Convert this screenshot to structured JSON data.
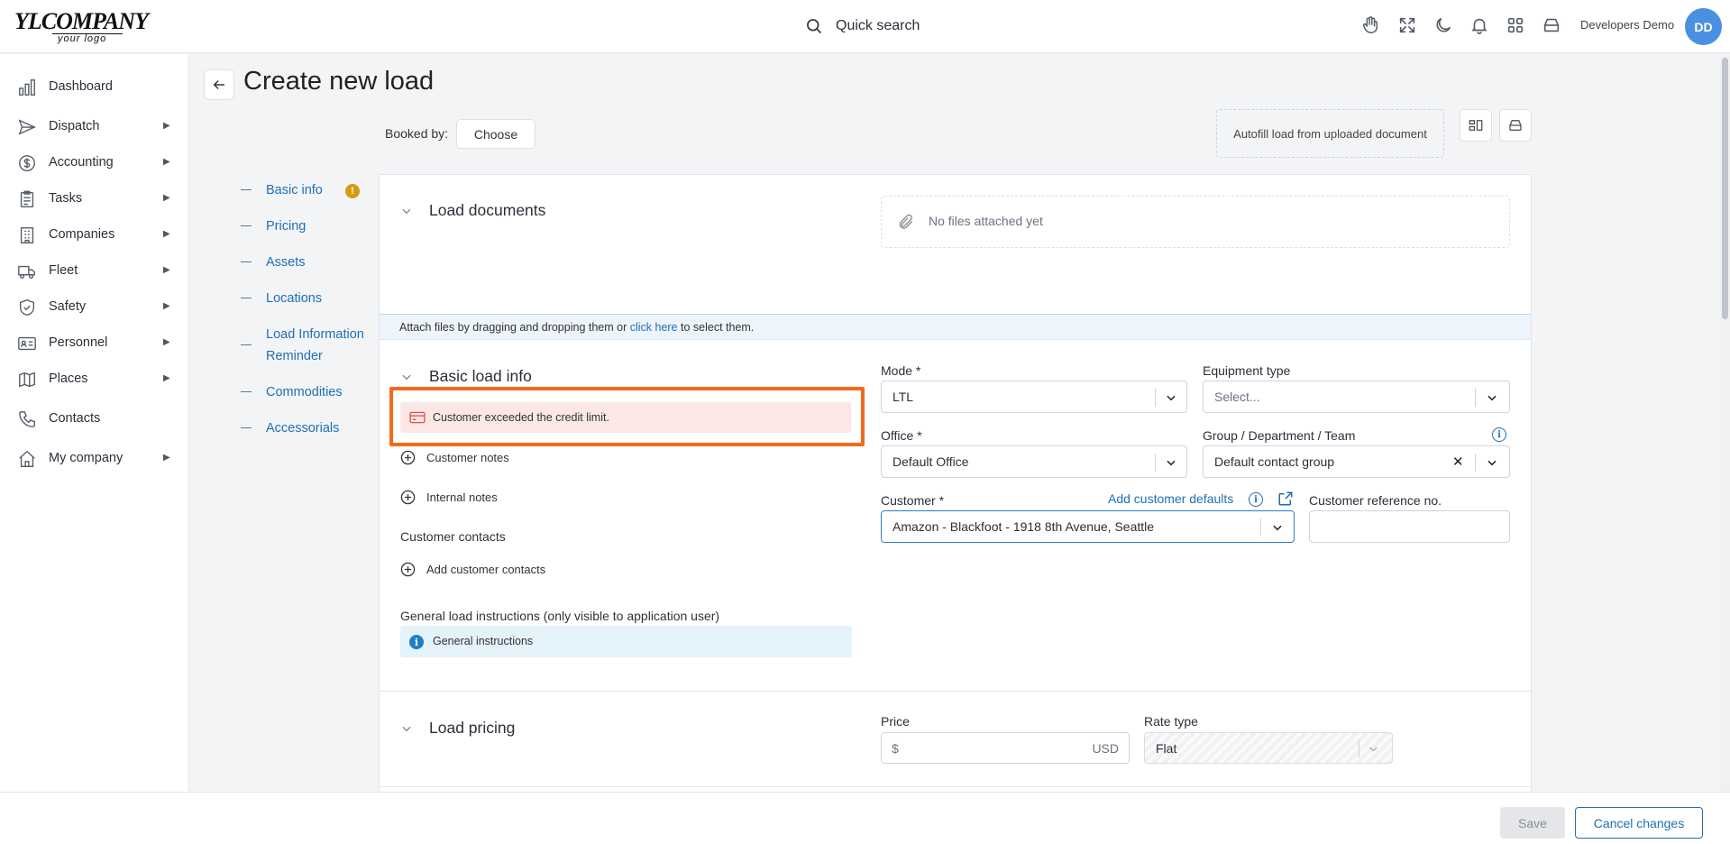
{
  "header": {
    "logo_main": "YLCOMPANY",
    "logo_sub": "your logo",
    "search_label": "Quick search",
    "user_name": "Developers Demo",
    "avatar_initials": "DD",
    "icons": [
      "hand-icon",
      "fullscreen-icon",
      "moon-icon",
      "bell-icon",
      "apps-grid-icon",
      "inbox-icon"
    ]
  },
  "sidebar": {
    "items": [
      {
        "label": "Dashboard",
        "icon": "dashboard-icon",
        "expandable": false
      },
      {
        "label": "Dispatch",
        "icon": "dispatch-icon",
        "expandable": true
      },
      {
        "label": "Accounting",
        "icon": "dollar-icon",
        "expandable": true
      },
      {
        "label": "Tasks",
        "icon": "clipboard-icon",
        "expandable": true
      },
      {
        "label": "Companies",
        "icon": "building-icon",
        "expandable": true
      },
      {
        "label": "Fleet",
        "icon": "truck-icon",
        "expandable": true
      },
      {
        "label": "Safety",
        "icon": "shield-icon",
        "expandable": true
      },
      {
        "label": "Personnel",
        "icon": "id-card-icon",
        "expandable": true
      },
      {
        "label": "Places",
        "icon": "map-icon",
        "expandable": true
      },
      {
        "label": "Contacts",
        "icon": "phone-icon",
        "expandable": false
      },
      {
        "label": "My company",
        "icon": "home-icon",
        "expandable": true
      }
    ],
    "arrow": "▶"
  },
  "page": {
    "title": "Create new load",
    "booked_by_label": "Booked by:",
    "choose_label": "Choose",
    "autofill_label": "Autofill load from uploaded document"
  },
  "section_nav": {
    "items": [
      "Basic info",
      "Pricing",
      "Assets",
      "Locations",
      "Load Information Reminder",
      "Commodities",
      "Accessorials"
    ],
    "warning_badge": "!"
  },
  "documents": {
    "title": "Load documents",
    "empty_text": "No files attached yet",
    "attach_prefix": "Attach files by dragging and dropping them or ",
    "attach_link": "click here",
    "attach_suffix": " to select them."
  },
  "basic_info": {
    "title": "Basic load info",
    "alert_text": "Customer exceeded the credit limit.",
    "customer_notes": "Customer notes",
    "internal_notes": "Internal notes",
    "customer_contacts_label": "Customer contacts",
    "add_customer_contacts": "Add customer contacts",
    "general_instructions_label": "General load instructions (only visible to application user)",
    "general_instructions_text": "General instructions",
    "info_glyph": "i"
  },
  "form": {
    "mode_label": "Mode *",
    "mode_value": "LTL",
    "equipment_label": "Equipment type",
    "equipment_placeholder": "Select...",
    "office_label": "Office *",
    "office_value": "Default Office",
    "group_label": "Group / Department / Team",
    "group_value": "Default contact group",
    "clear_glyph": "✕",
    "customer_label": "Customer *",
    "add_customer_defaults": "Add customer defaults",
    "customer_value": "Amazon - Blackfoot - 1918 8th Avenue, Seattle",
    "customer_ref_label": "Customer reference no.",
    "customer_ref_value": ""
  },
  "pricing": {
    "title": "Load pricing",
    "price_label": "Price",
    "currency_symbol": "$",
    "currency_code": "USD",
    "rate_type_label": "Rate type",
    "rate_type_value": "Flat"
  },
  "footer": {
    "save_label": "Save",
    "cancel_label": "Cancel changes"
  },
  "colors": {
    "accent": "#1f6fb5",
    "highlight": "#f26a1b",
    "alert_bg": "#fbe7e6",
    "info_bg": "#e4f2fa",
    "avatar_bg": "#4a90e2"
  }
}
